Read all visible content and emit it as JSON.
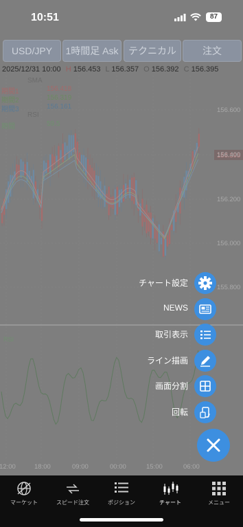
{
  "status_bar": {
    "time": "10:51",
    "battery": "87"
  },
  "toolbar": {
    "symbol": "USD/JPY",
    "timeframe": "1時間足 Ask",
    "technical": "テクニカル",
    "order": "注文"
  },
  "ohlc": {
    "datetime": "2025/12/31 10:00",
    "h_label": "H",
    "h": "156.453",
    "l_label": "L",
    "l": "156.357",
    "o_label": "O",
    "o": "156.392",
    "c_label": "C",
    "c": "156.395"
  },
  "indicators": {
    "sma_title": "SMA",
    "sma_rows": [
      {
        "label": "期間1",
        "value": "156.418"
      },
      {
        "label": "期間2",
        "value": "156.319"
      },
      {
        "label": "期間3",
        "value": "156.161"
      }
    ],
    "rsi_title": "RSI",
    "rsi_row": {
      "label": "期間",
      "value": "59.5"
    }
  },
  "chart_data": {
    "type": "candlestick",
    "price_axis_ticks": [
      "156.600",
      "156.400",
      "156.200",
      "156.000",
      "155.800"
    ],
    "current_price": "156.395",
    "time_axis_ticks": [
      "12:00",
      "18:00",
      "09:00",
      "00:00",
      "15:00",
      "06:00"
    ],
    "rsi_label": "RSI"
  },
  "fab_menu": {
    "items": [
      {
        "label": "チャート設定",
        "icon": "gear-icon"
      },
      {
        "label": "NEWS",
        "icon": "news-icon"
      },
      {
        "label": "取引表示",
        "icon": "list-icon"
      },
      {
        "label": "ライン描画",
        "icon": "pencil-icon"
      },
      {
        "label": "画面分割",
        "icon": "split-screen-icon"
      },
      {
        "label": "回転",
        "icon": "rotate-icon"
      }
    ]
  },
  "tabs": [
    {
      "label": "マーケット",
      "icon": "globe-icon"
    },
    {
      "label": "スピード注文",
      "icon": "speed-order-icon"
    },
    {
      "label": "ポジション",
      "icon": "position-list-icon"
    },
    {
      "label": "チャート",
      "icon": "candlestick-icon"
    },
    {
      "label": "メニュー",
      "icon": "menu-grid-icon"
    }
  ],
  "colors": {
    "accent": "#3d8fe0",
    "overlay": "#7e7e7e",
    "tabbar": "#0e0e0e"
  }
}
